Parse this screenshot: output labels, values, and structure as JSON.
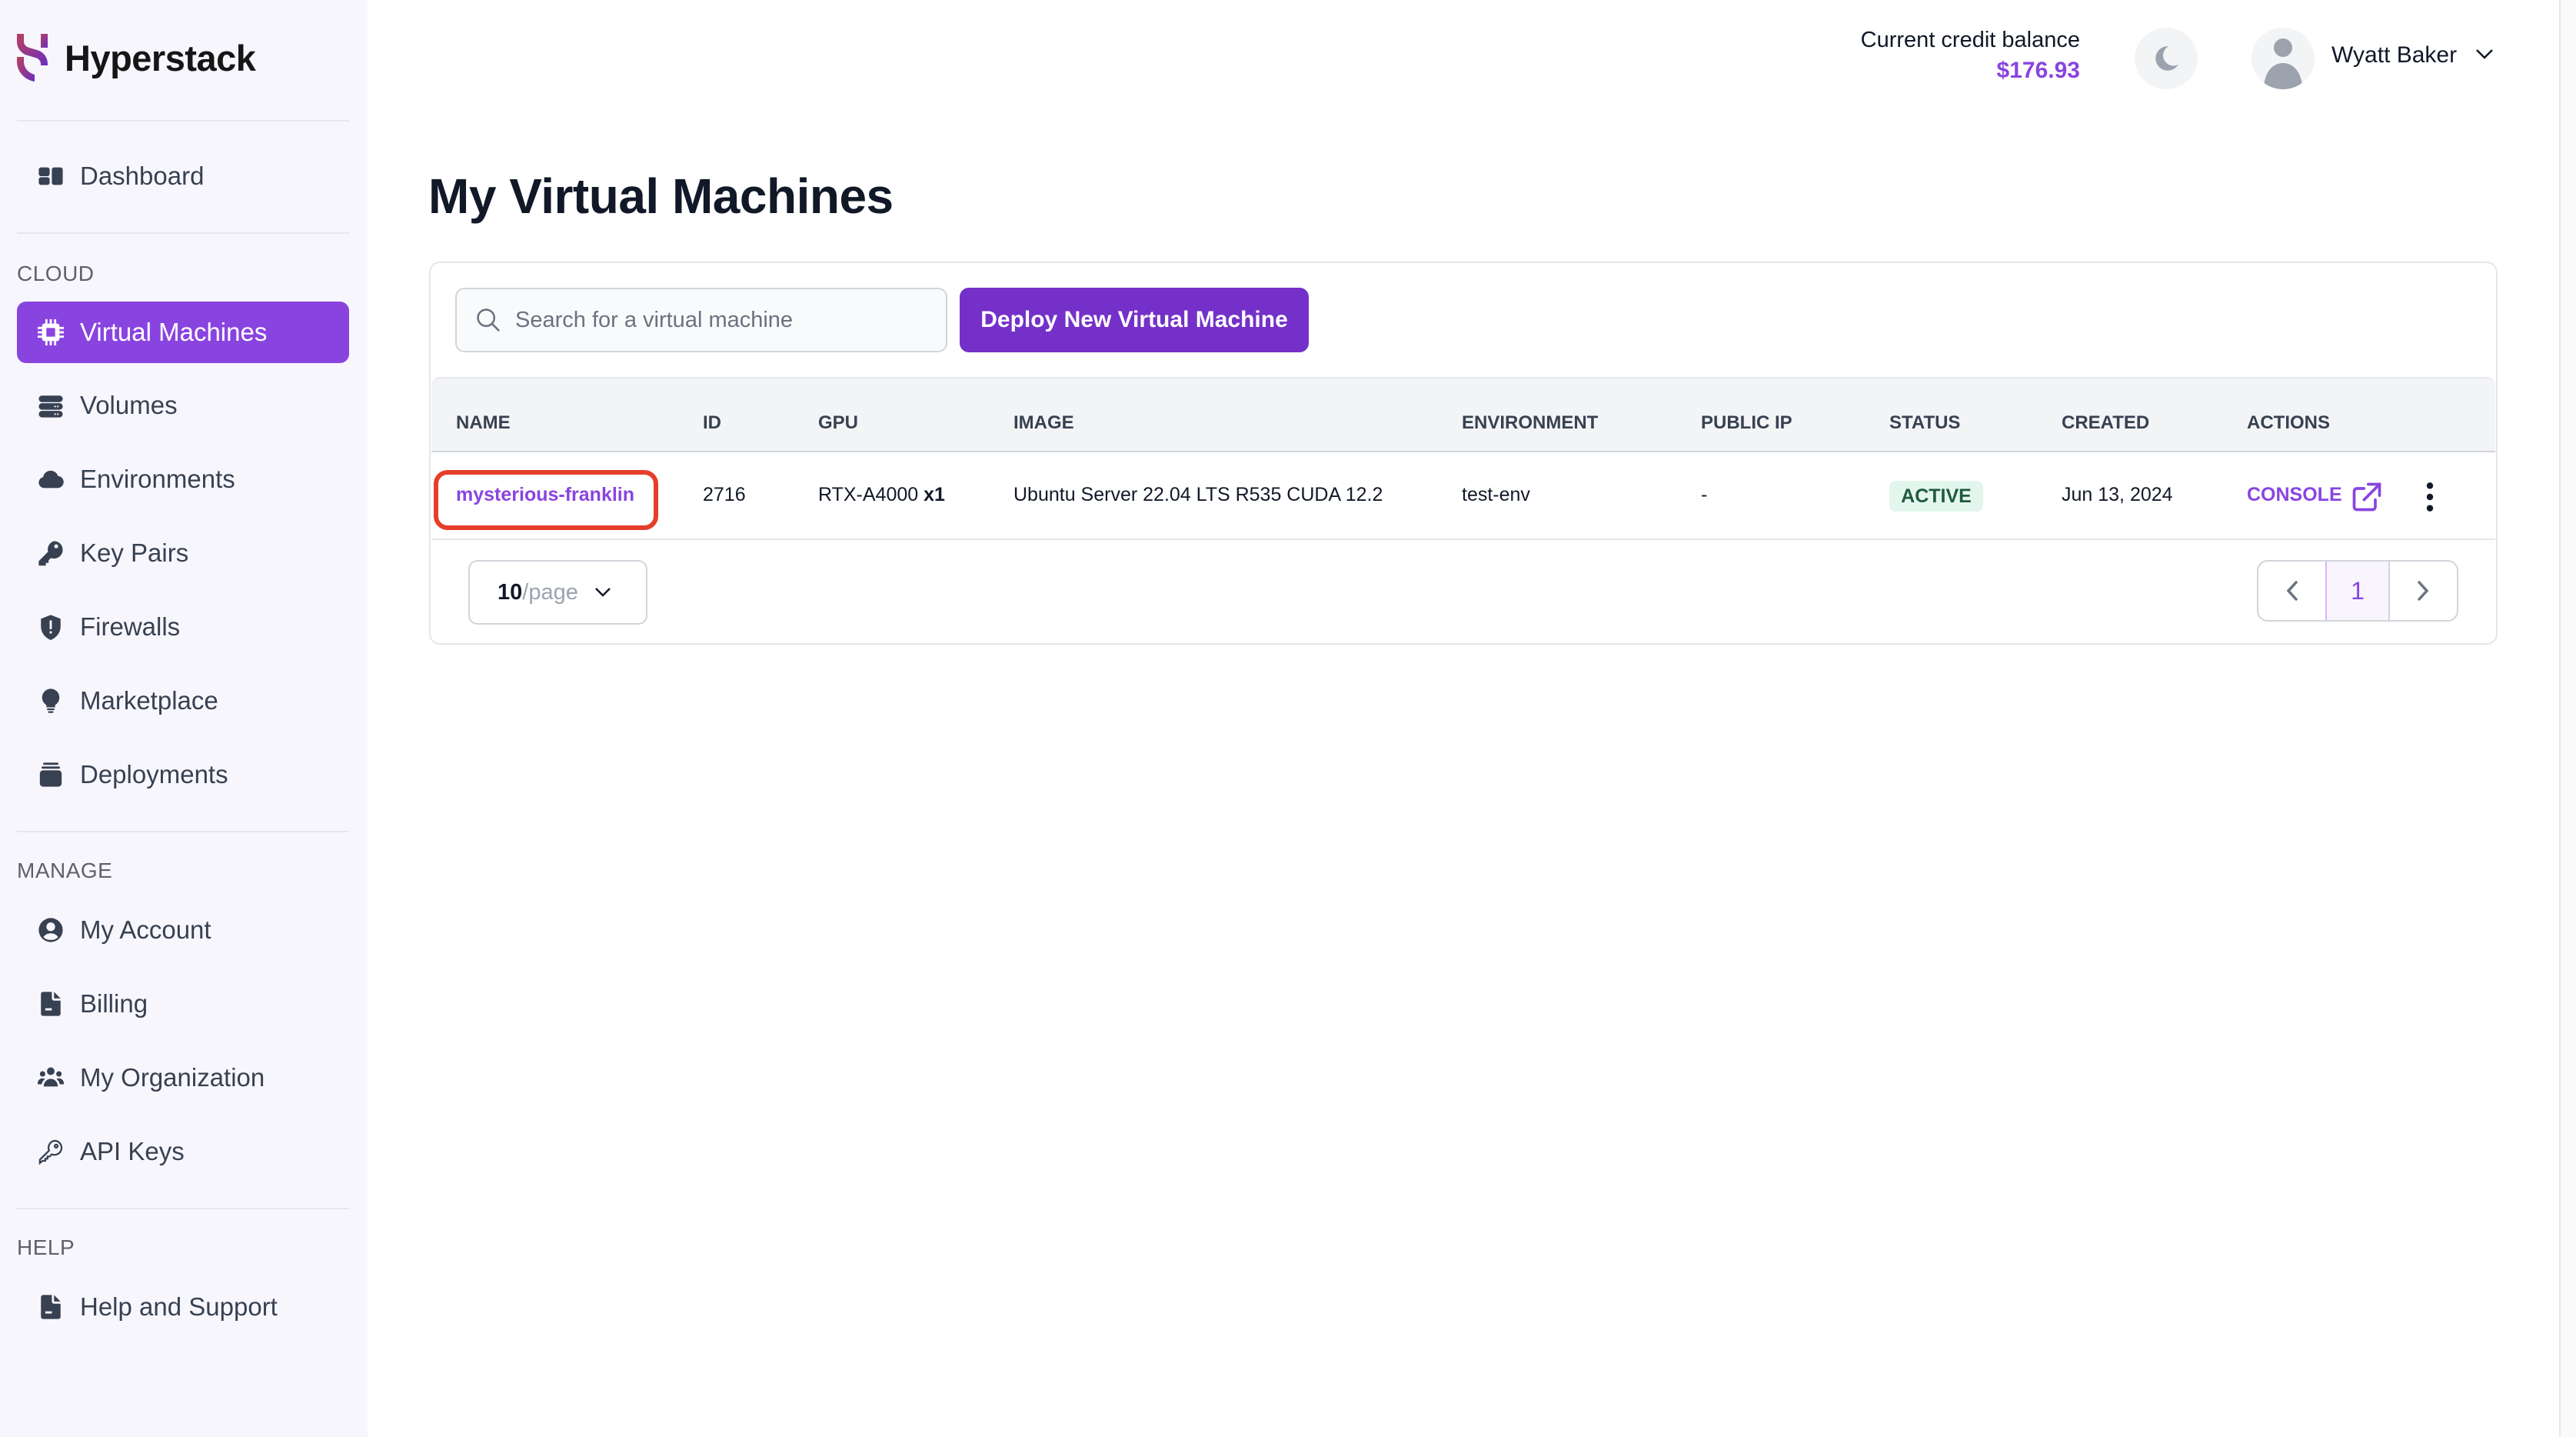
{
  "app": {
    "brand": "Hyperstack",
    "brand_colors": {
      "accent": "#8944e0",
      "button": "#7430c9",
      "highlight": "#e53e2a"
    }
  },
  "sidebar": {
    "top_items": [
      {
        "label": "Dashboard",
        "icon": "dashboard-icon"
      }
    ],
    "sections": [
      {
        "label": "CLOUD",
        "items": [
          {
            "label": "Virtual Machines",
            "icon": "chip-icon",
            "active": true
          },
          {
            "label": "Volumes",
            "icon": "database-icon"
          },
          {
            "label": "Environments",
            "icon": "cloud-icon"
          },
          {
            "label": "Key Pairs",
            "icon": "key-icon"
          },
          {
            "label": "Firewalls",
            "icon": "shield-icon"
          },
          {
            "label": "Marketplace",
            "icon": "lightbulb-icon"
          },
          {
            "label": "Deployments",
            "icon": "stack-icon"
          }
        ]
      },
      {
        "label": "MANAGE",
        "items": [
          {
            "label": "My Account",
            "icon": "user-circle-icon"
          },
          {
            "label": "Billing",
            "icon": "document-icon"
          },
          {
            "label": "My Organization",
            "icon": "users-icon"
          },
          {
            "label": "API Keys",
            "icon": "key-outline-icon"
          }
        ]
      },
      {
        "label": "HELP",
        "items": [
          {
            "label": "Help and Support",
            "icon": "document-icon"
          }
        ]
      }
    ]
  },
  "header": {
    "credit_label": "Current credit balance",
    "credit_value": "$176.93",
    "theme_toggle_icon": "moon-icon",
    "user_name": "Wyatt Baker"
  },
  "main": {
    "title": "My Virtual Machines",
    "search_placeholder": "Search for a virtual machine",
    "search_value": "",
    "deploy_button": "Deploy New Virtual Machine",
    "table": {
      "columns": [
        "NAME",
        "ID",
        "GPU",
        "IMAGE",
        "ENVIRONMENT",
        "PUBLIC IP",
        "STATUS",
        "CREATED",
        "ACTIONS"
      ],
      "rows": [
        {
          "name": "mysterious-franklin",
          "id": "2716",
          "gpu": "RTX-A4000",
          "gpu_count": "x1",
          "image": "Ubuntu Server 22.04 LTS R535 CUDA 12.2",
          "environment": "test-env",
          "public_ip": "-",
          "status": "ACTIVE",
          "created": "Jun 13, 2024",
          "action_label": "CONSOLE"
        }
      ]
    },
    "pagination": {
      "per_page_value": "10",
      "per_page_unit": "/page",
      "current_page": "1"
    }
  }
}
